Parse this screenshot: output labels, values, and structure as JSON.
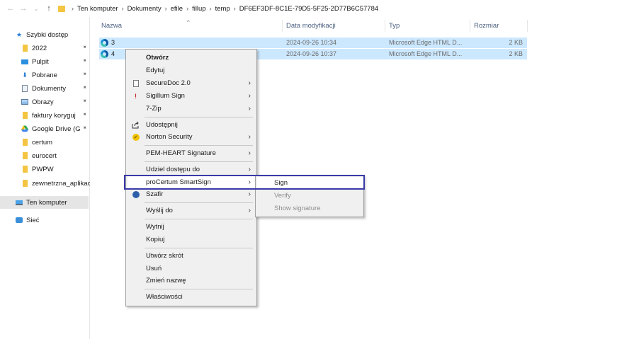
{
  "address": {
    "back": "←",
    "forward": "→",
    "dropdown": "⌄",
    "up": "↑",
    "crumbs": [
      "Ten komputer",
      "Dokumenty",
      "efile",
      "fillup",
      "temp",
      "DF6EF3DF-8C1E-79D5-5F25-2D77B6C57784"
    ]
  },
  "sidebar": {
    "quick_access": "Szybki dostęp",
    "items": [
      "2022",
      "Pulpit",
      "Pobrane",
      "Dokumenty",
      "Obrazy",
      "faktury koryguj",
      "Google Drive (G",
      "certum",
      "eurocert",
      "PWPW",
      "zewnetrzna_aplikac"
    ],
    "this_pc": "Ten komputer",
    "network": "Sieć"
  },
  "columns": {
    "name": "Nazwa",
    "modified": "Data modyfikacji",
    "type": "Typ",
    "size": "Rozmiar"
  },
  "files": [
    {
      "name": "3",
      "modified": "2024-09-26 10:34",
      "type": "Microsoft Edge HTML D...",
      "size": "2 KB"
    },
    {
      "name": "4",
      "modified": "2024-09-26 10:37",
      "type": "Microsoft Edge HTML D...",
      "size": "2 KB"
    }
  ],
  "context_menu": {
    "open": "Otwórz",
    "edit": "Edytuj",
    "securedoc": "SecureDoc 2.0",
    "sigillum": "Sigillum Sign",
    "zip": "7-Zip",
    "share": "Udostępnij",
    "norton": "Norton Security",
    "pemheart": "PEM-HEART Signature",
    "give_access": "Udziel dostępu do",
    "procertum": "proCertum SmartSign",
    "szafir": "Szafir",
    "send_to": "Wyślij do",
    "cut": "Wytnij",
    "copy": "Kopiuj",
    "shortcut": "Utwórz skrót",
    "delete": "Usuń",
    "rename": "Zmień nazwę",
    "properties": "Właściwości"
  },
  "submenu": {
    "sign": "Sign",
    "verify": "Verify",
    "show": "Show signature"
  },
  "colors": {
    "selection": "#cce8ff",
    "highlight_box": "#3a3aaa",
    "menu_bg": "#f0f0f0"
  }
}
